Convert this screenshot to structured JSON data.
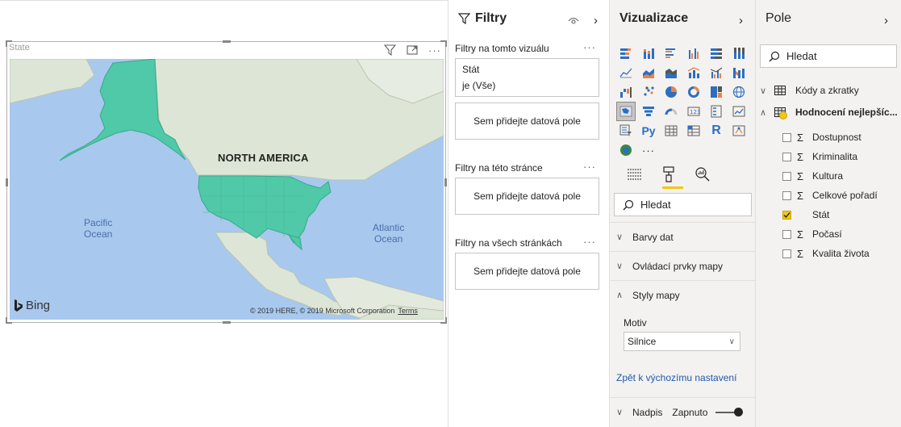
{
  "canvas": {
    "visual_title": "State",
    "map": {
      "region_label": "NORTH AMERICA",
      "ocean_pacific": "Pacific\nOcean",
      "ocean_atlantic": "Atlantic\nOcean",
      "brand": "Bing",
      "copyright": "© 2019 HERE, © 2019 Microsoft Corporation",
      "terms": "Terms",
      "highlight_color": "#4fc9a7",
      "water_color": "#a8c8ee",
      "land_color": "#dde6d6"
    }
  },
  "filters": {
    "title": "Filtry",
    "sections": [
      {
        "title": "Filtry na tomto vizuálu",
        "more": "···"
      },
      {
        "title": "Filtry na této stránce",
        "more": "···"
      },
      {
        "title": "Filtry na všech stránkách",
        "more": "···"
      }
    ],
    "card": {
      "field": "Stát",
      "condition": "je (Vše)"
    },
    "drop_text": "Sem přidejte datová pole"
  },
  "visualizations": {
    "title": "Vizualizace",
    "more_label": "···",
    "search_placeholder": "Hledat",
    "sections": {
      "data_colors": "Barvy dat",
      "map_controls": "Ovládací prvky mapy",
      "map_styles": "Styly mapy",
      "title_section": "Nadpis"
    },
    "motiv_label": "Motiv",
    "motiv_value": "Silnice",
    "reset_link": "Zpět k výchozímu nastavení",
    "title_toggle": "Zapnuto"
  },
  "fields": {
    "title": "Pole",
    "search_placeholder": "Hledat",
    "tables": [
      {
        "name": "Kódy a zkratky",
        "expanded": false
      },
      {
        "name": "Hodnocení nejlepšíc...",
        "expanded": true
      }
    ],
    "items": [
      {
        "name": "Dostupnost",
        "checked": false,
        "sigma": "Σ"
      },
      {
        "name": "Kriminalita",
        "checked": false,
        "sigma": "Σ"
      },
      {
        "name": "Kultura",
        "checked": false,
        "sigma": "Σ"
      },
      {
        "name": "Celkové pořadí",
        "checked": false,
        "sigma": "Σ"
      },
      {
        "name": "Stát",
        "checked": true,
        "sigma": ""
      },
      {
        "name": "Počasí",
        "checked": false,
        "sigma": "Σ"
      },
      {
        "name": "Kvalita života",
        "checked": false,
        "sigma": "Σ"
      }
    ],
    "accent_color": "#f2c811"
  }
}
